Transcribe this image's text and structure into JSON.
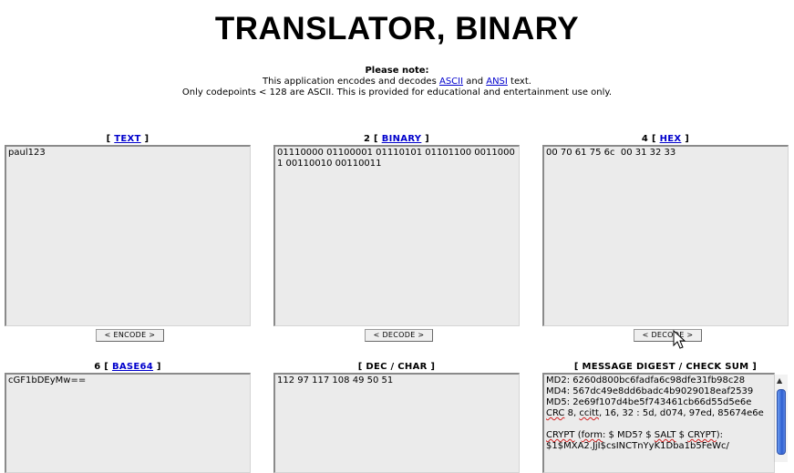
{
  "title": "TRANSLATOR, BINARY",
  "note": {
    "heading": "Please note:",
    "line1_pre": "This application encodes and decodes ",
    "ascii": "ASCII",
    "and": " and ",
    "ansi": "ANSI",
    "line1_post": " text.",
    "line2": "Only codepoints < 128 are ASCII. This is provided for educational and entertainment use only."
  },
  "panels": {
    "text": {
      "prefix": "[ ",
      "link": "TEXT",
      "suffix": " ]",
      "value": "paul123"
    },
    "binary": {
      "prefix": "2 [ ",
      "link": "BINARY",
      "suffix": " ]",
      "value": "01110000 01100001 01110101 01101100 00110001 00110010 00110011"
    },
    "hex": {
      "prefix": "4 [ ",
      "link": "HEX",
      "suffix": " ]",
      "value": "00 70 61 75 6c  00 31 32 33"
    },
    "base64": {
      "prefix": "6 [ ",
      "link": "BASE64",
      "suffix": " ]",
      "value": "cGF1bDEyMw=="
    },
    "dec": {
      "label": "[ DEC / CHAR ]",
      "value": "112 97 117 108 49 50 51"
    },
    "digest": {
      "label": "[ MESSAGE DIGEST / CHECK SUM ]",
      "md2": "MD2: 6260d800bc6fadfa6c98dfe31fb98c28",
      "md4": "MD4: 567dc49e8dd6badc4b9029018eaf2539",
      "md5": "MD5: 2e69f107d4be5f743461cb66d55d5e6e",
      "crc_word": "CRC",
      "crc_a": " 8, ",
      "ccitt": "ccitt",
      "crc_b": ", 16, 32 : 5d, d074, 97ed, 85674e6e",
      "crypt_word": "CRYPT",
      "crypt_a": " (",
      "form_word": "form",
      "crypt_b": ": $ MD5? $ ",
      "salt_word": "SALT",
      "crypt_c": " $ ",
      "crypt_word2": "CRYPT",
      "crypt_d": "):",
      "crypt_value": "$1$MXA2.JjI$csINCTnYyK1Dba1b5FeWc/"
    }
  },
  "buttons": {
    "encode": "< ENCODE >",
    "decode_binary": "< DECODE >",
    "decode_hex": "< DECODE >"
  }
}
